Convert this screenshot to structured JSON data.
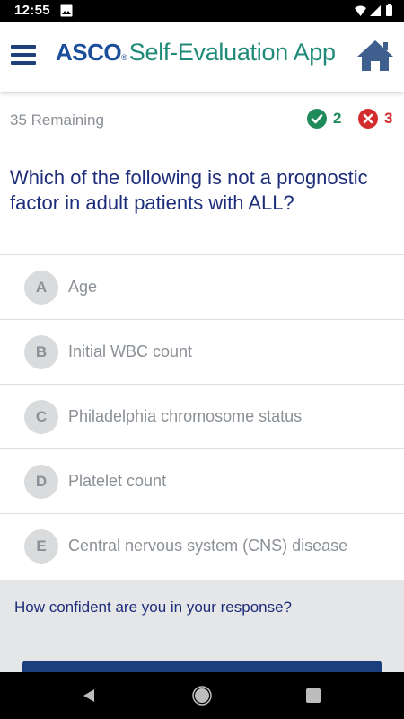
{
  "status_bar": {
    "time": "12:55",
    "icons": [
      "image-icon",
      "wifi-icon",
      "signal-icon",
      "battery-icon"
    ]
  },
  "app_bar": {
    "brand": "ASCO",
    "brand_mark": "®",
    "title": "Self-Evaluation App",
    "icons": [
      "menu-icon",
      "home-icon"
    ],
    "colors": {
      "brand": "#1b4e9b",
      "title": "#1f8a78"
    }
  },
  "progress": {
    "remaining": "35 Remaining",
    "correct": "2",
    "incorrect": "3"
  },
  "question": {
    "text": "Which of the following is not a prognostic factor in adult patients with ALL?"
  },
  "options": [
    {
      "letter": "A",
      "text": "Age"
    },
    {
      "letter": "B",
      "text": "Initial WBC count"
    },
    {
      "letter": "C",
      "text": "Philadelphia chromosome status"
    },
    {
      "letter": "D",
      "text": "Platelet count"
    },
    {
      "letter": "E",
      "text": "Central nervous system (CNS) disease"
    }
  ],
  "confidence": {
    "prompt": "How confident are you in your response?"
  },
  "nav_bar": {
    "icons": [
      "back-icon",
      "home-circle-icon",
      "recents-icon"
    ]
  },
  "colors": {
    "question": "#1d2d7a",
    "correct": "#1f8a5a",
    "incorrect": "#d32c2c",
    "primary_button": "#1b3f7c"
  }
}
